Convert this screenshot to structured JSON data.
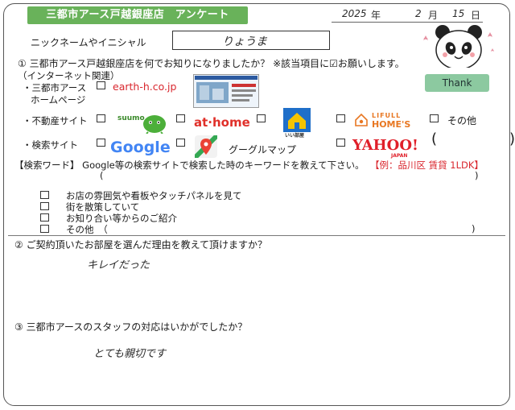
{
  "header": {
    "title": "三都市アース戸越銀座店　アンケート",
    "date": {
      "year": "2025",
      "year_unit": "年",
      "month": "2",
      "month_unit": "月",
      "day": "15",
      "day_unit": "日"
    }
  },
  "nickname": {
    "label": "ニックネームやイニシャル",
    "value": "りょうま"
  },
  "mascot": {
    "badge": "Thank"
  },
  "q1": {
    "question": "① 三都市アース戸越銀座店を何でお知りになりましたか？ ※該当項目に☑お願いします。",
    "internet_label": "（インターネット関連）",
    "homepage_label_1": "・三都市アース",
    "homepage_label_2": "ホームページ",
    "homepage_url": "earth-h.co.jp",
    "realestate_label": "・不動産サイト",
    "suumo": "suumo",
    "athome": "at·home",
    "chintai": "いい部屋",
    "lifull_1": "LIFULL",
    "lifull_2": "HOME'S",
    "other_label": "その他",
    "other_parens": "(　　　　　)",
    "search_label": "・検索サイト",
    "google": "Google",
    "googlemap": "グーグルマップ",
    "yahoo": "YAHOO!",
    "yahoo_sub": "JAPAN",
    "keyword_label": "【検索ワード】 Google等の検索サイトで検索した時のキーワードを教えて下さい。",
    "keyword_example": "【例：品川区 賃貸 1LDK】",
    "keyword_parens_open": "(",
    "keyword_parens_close": ")",
    "offline_options": [
      "お店の雰囲気や看板やタッチパネルを見て",
      "街を散策していて",
      "お知り合い等からのご紹介",
      "その他　（"
    ],
    "offline_other_close": ")"
  },
  "q2": {
    "question": "② ご契約頂いたお部屋を選んだ理由を教えて頂けますか？",
    "answer": "キレイだった"
  },
  "q3": {
    "question": "③ 三都市アースのスタッフの対応はいかがでしたか？",
    "answer": "とても親切です"
  }
}
